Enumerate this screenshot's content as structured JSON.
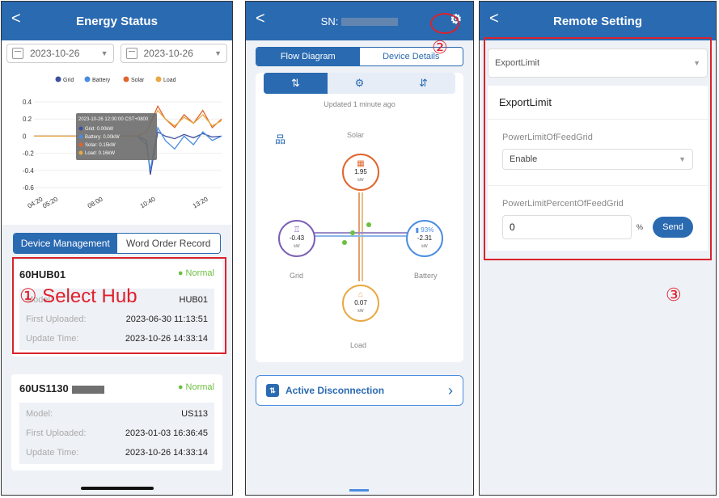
{
  "panel1": {
    "title": "Energy Status",
    "back_icon": "chevron-left-icon",
    "date_start": "2023-10-26",
    "date_end": "2023-10-26",
    "legend": [
      {
        "label": "Grid",
        "color": "#3d4f9e"
      },
      {
        "label": "Battery",
        "color": "#4a8de0"
      },
      {
        "label": "Solar",
        "color": "#e0642b"
      },
      {
        "label": "Load",
        "color": "#e8a842"
      }
    ],
    "tooltip": {
      "time": "2023-10-26 12:00:00 CST+0800",
      "lines": [
        "Grid: 0.00kW",
        "Battery: 0.00kW",
        "Solar: 0.15kW",
        "Load: 0.16kW"
      ]
    },
    "tabs": {
      "management": "Device Management",
      "work_order": "Word Order Record"
    },
    "devices": [
      {
        "id": "60HUB01",
        "status": "Normal",
        "model_label": "Model:",
        "model": "HUB01",
        "first_label": "First Uploaded:",
        "first": "2023-06-30 11:13:51",
        "update_label": "Update Time:",
        "update": "2023-10-26 14:33:14"
      },
      {
        "id": "60US1130",
        "status": "Normal",
        "model_label": "Model:",
        "model": "US113",
        "first_label": "First Uploaded:",
        "first": "2023-01-03 16:36:45",
        "update_label": "Update Time:",
        "update": "2023-10-26 14:33:14"
      }
    ],
    "annotation": "① Select Hub"
  },
  "chart_data": {
    "type": "line",
    "x_ticks": [
      "04:20",
      "05:20",
      "08:00",
      "10:40",
      "13:20"
    ],
    "y_ticks": [
      "0.4",
      "0.2",
      "0",
      "-0.2",
      "-0.4",
      "-0.6"
    ],
    "ylim": [
      -0.6,
      0.4
    ],
    "series": [
      {
        "name": "Grid",
        "color": "#3d4f9e",
        "x": [
          0,
          0.55,
          0.6,
          0.62,
          0.66,
          0.7,
          0.75,
          0.8,
          0.85,
          0.9,
          0.95,
          1.0
        ],
        "values": [
          0,
          0,
          -0.05,
          -0.45,
          0.05,
          0.0,
          -0.03,
          0.02,
          -0.02,
          0.03,
          -0.01,
          0.0
        ]
      },
      {
        "name": "Battery",
        "color": "#4a8de0",
        "x": [
          0,
          0.55,
          0.6,
          0.62,
          0.66,
          0.7,
          0.75,
          0.8,
          0.85,
          0.9,
          0.95,
          1.0
        ],
        "values": [
          0,
          0,
          -0.1,
          -0.4,
          0.1,
          -0.05,
          -0.15,
          0.0,
          -0.1,
          0.05,
          -0.05,
          0.0
        ]
      },
      {
        "name": "Solar",
        "color": "#e0642b",
        "x": [
          0,
          0.55,
          0.6,
          0.62,
          0.66,
          0.7,
          0.75,
          0.8,
          0.85,
          0.9,
          0.95,
          1.0
        ],
        "values": [
          0,
          0,
          0.05,
          0.15,
          0.35,
          0.2,
          0.1,
          0.25,
          0.15,
          0.3,
          0.1,
          0.2
        ]
      },
      {
        "name": "Load",
        "color": "#e8a842",
        "x": [
          0,
          0.55,
          0.6,
          0.62,
          0.66,
          0.7,
          0.75,
          0.8,
          0.85,
          0.9,
          0.95,
          1.0
        ],
        "values": [
          0,
          0,
          0.05,
          0.15,
          0.3,
          0.2,
          0.12,
          0.22,
          0.15,
          0.25,
          0.12,
          0.18
        ]
      }
    ]
  },
  "panel2": {
    "sn_label": "SN:",
    "seg_flow": "Flow Diagram",
    "seg_details": "Device Details",
    "updated": "Updated 1 minute ago",
    "solar": {
      "label": "Solar",
      "value": "1.95",
      "unit": "kW",
      "color": "#e0642b"
    },
    "grid": {
      "label": "Grid",
      "value": "-0.43",
      "unit": "kW",
      "color": "#7b5fb5"
    },
    "battery": {
      "label": "Battery",
      "value": "-2.31",
      "unit": "kW",
      "soc": "93%",
      "color": "#4a8de0"
    },
    "load": {
      "label": "Load",
      "value": "0.07",
      "unit": "kW",
      "color": "#e8a842"
    },
    "active_disconnection": "Active Disconnection",
    "annotation": "②"
  },
  "panel3": {
    "title": "Remote Setting",
    "select_value": "ExportLimit",
    "section_title": "ExportLimit",
    "field1_label": "PowerLimitOfFeedGrid",
    "field1_value": "Enable",
    "field2_label": "PowerLimitPercentOfFeedGrid",
    "field2_value": "0",
    "unit": "%",
    "send": "Send",
    "annotation": "③"
  }
}
